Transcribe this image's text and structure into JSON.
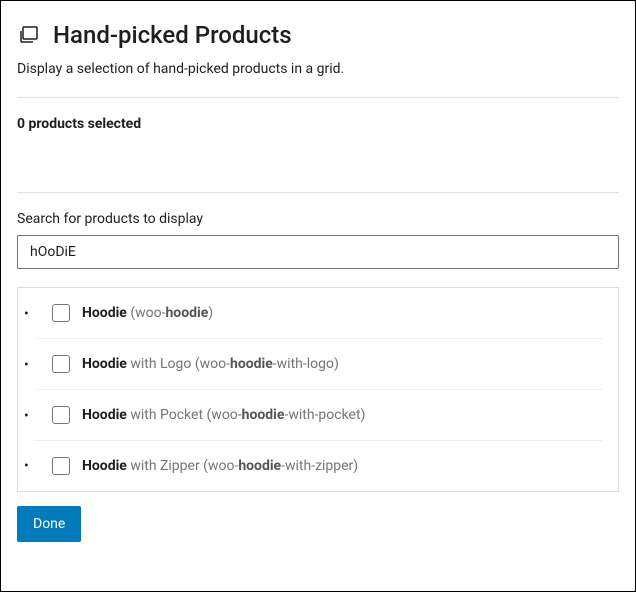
{
  "header": {
    "title": "Hand-picked Products",
    "icon": "gallery-icon"
  },
  "description": "Display a selection of hand-picked products in a grid.",
  "selected_count_text": "0 products selected",
  "search": {
    "label": "Search for products to display",
    "value": "hOoDiE"
  },
  "results": [
    {
      "name_bold": "Hoodie",
      "name_rest": "",
      "slug_pre": " (woo-",
      "slug_bold": "hoodie",
      "slug_post": ")"
    },
    {
      "name_bold": "Hoodie",
      "name_rest": " with Logo",
      "slug_pre": " (woo-",
      "slug_bold": "hoodie",
      "slug_post": "-with-logo)"
    },
    {
      "name_bold": "Hoodie",
      "name_rest": " with Pocket",
      "slug_pre": " (woo-",
      "slug_bold": "hoodie",
      "slug_post": "-with-pocket)"
    },
    {
      "name_bold": "Hoodie",
      "name_rest": " with Zipper",
      "slug_pre": " (woo-",
      "slug_bold": "hoodie",
      "slug_post": "-with-zipper)"
    }
  ],
  "done_button_label": "Done"
}
